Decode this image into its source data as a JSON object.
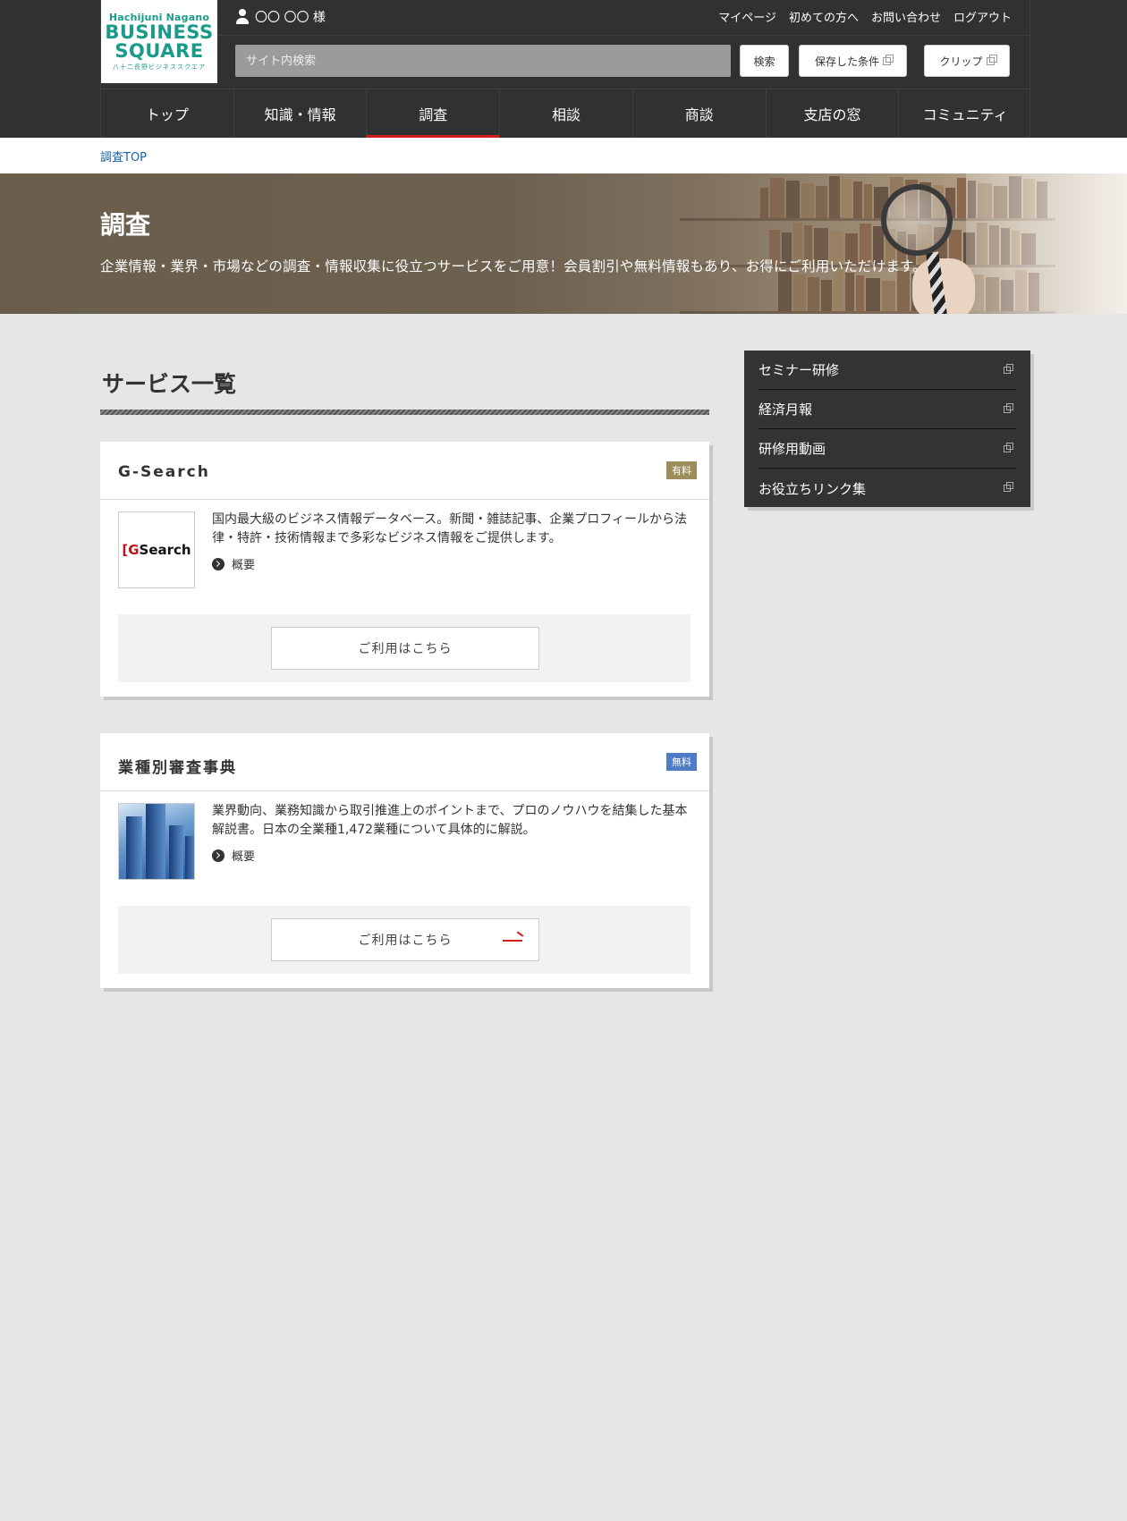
{
  "header": {
    "logo": {
      "line1": "Hachijuni Nagano",
      "line2a": "BUSINESS",
      "line2b": "SQUARE",
      "line3": "八十二長野ビジネススクエア"
    },
    "user_name": "〇〇 〇〇 様",
    "top_links": [
      "マイページ",
      "初めての方へ",
      "お問い合わせ",
      "ログアウト"
    ],
    "search_placeholder": "サイト内検索",
    "search_button": "検索",
    "saved_button": "保存した条件",
    "clip_button": "クリップ"
  },
  "nav": {
    "items": [
      "トップ",
      "知識・情報",
      "調査",
      "相談",
      "商談",
      "支店の窓",
      "コミュニティ"
    ],
    "active": "調査"
  },
  "breadcrumb": "調査TOP",
  "hero": {
    "title": "調査",
    "description": "企業情報・業界・市場などの調査・情報収集に役立つサービスをご用意！会員割引や無料情報もあり、お得にご利用いただけます。"
  },
  "main": {
    "section_title": "サービス一覧",
    "cards": [
      {
        "title": "G-Search",
        "badge": "有料",
        "logo_text_a": "[G",
        "logo_text_b": "Search",
        "description": "国内最大級のビジネス情報データベース。新聞・雑誌記事、企業プロフィールから法律・特許・技術情報まで多彩なビジネス情報をご提供します。",
        "more": "概要",
        "button": "ご利用はこちら"
      },
      {
        "title": "業種別審査事典",
        "badge": "無料",
        "description": "業界動向、業務知識から取引推進上のポイントまで、プロのノウハウを結集した基本解説書。日本の全業種1,472業種について具体的に解説。",
        "more": "概要",
        "button": "ご利用はこちら"
      }
    ]
  },
  "sidebar": {
    "items": [
      "セミナー研修",
      "経済月報",
      "研修用動画",
      "お役立ちリンク集"
    ]
  },
  "colors": {
    "header_bg": "#2f3133",
    "accent_red": "#d31b1b",
    "link_blue": "#1a5fa8",
    "badge_paid": "#9a8f5a",
    "badge_free": "#4f7cc7",
    "logo_teal": "#1a9a8a"
  }
}
